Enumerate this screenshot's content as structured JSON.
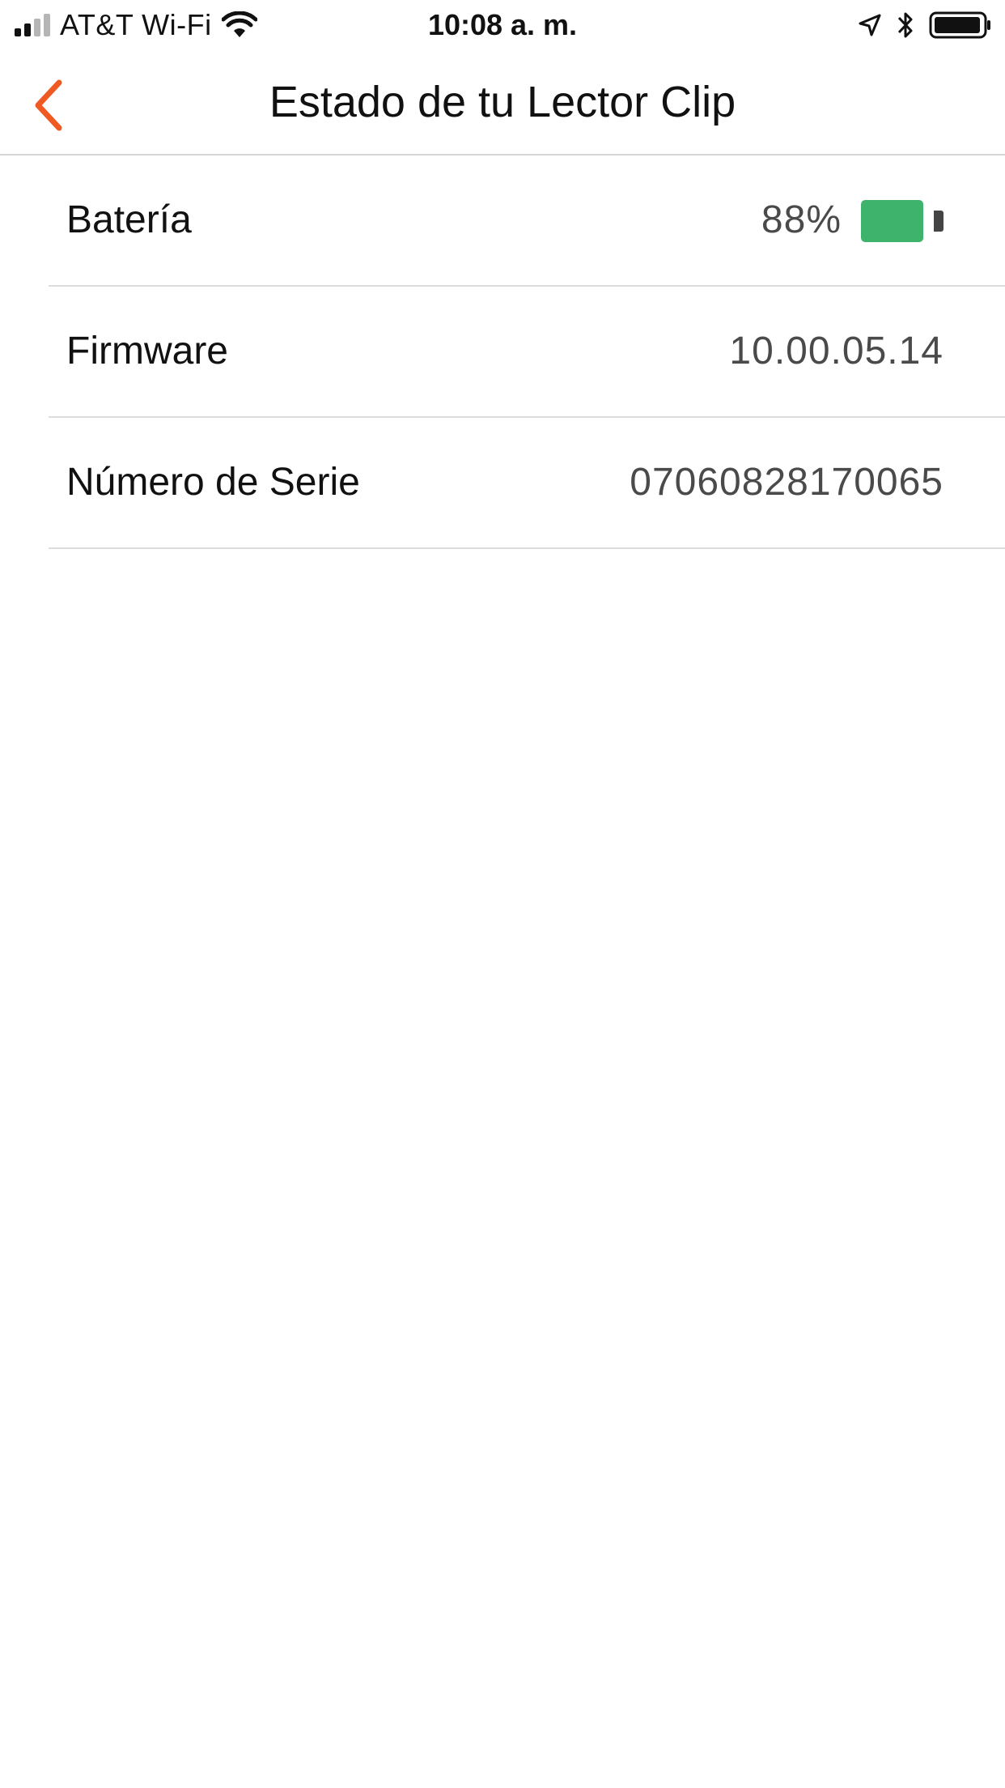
{
  "status_bar": {
    "carrier": "AT&T Wi-Fi",
    "time": "10:08 a. m.",
    "signal_bars_filled": 2,
    "signal_bars_total": 4,
    "icons": [
      "signal-icon",
      "wifi-icon",
      "location-arrow-icon",
      "bluetooth-icon",
      "battery-icon"
    ]
  },
  "nav": {
    "title": "Estado de tu Lector Clip",
    "back_icon": "chevron-left-icon"
  },
  "rows": [
    {
      "label": "Batería",
      "value": "88%",
      "battery_level": 0.88
    },
    {
      "label": "Firmware",
      "value": "10.00.05.14"
    },
    {
      "label": "Número de Serie",
      "value": "07060828170065"
    }
  ],
  "colors": {
    "accent": "#f05a22",
    "battery_green": "#3db36b",
    "separator": "#dcdcdc"
  }
}
